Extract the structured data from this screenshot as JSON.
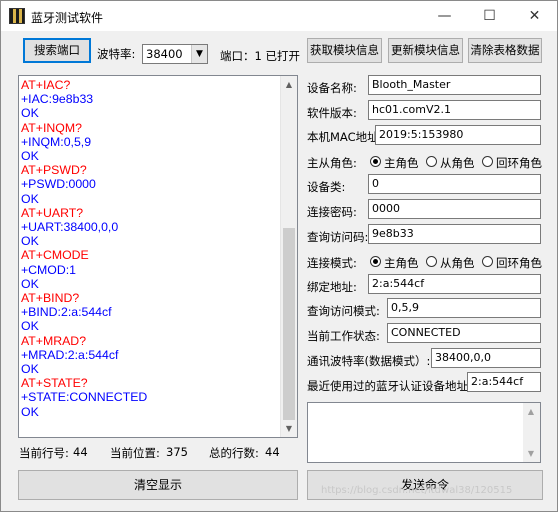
{
  "window": {
    "title": "蓝牙测试软件",
    "minimize_glyph": "—",
    "maximize_glyph": "☐",
    "close_glyph": "✕"
  },
  "toolbar": {
    "search_port_label": "搜索端口",
    "baud_label": "波特率:",
    "baud_value": "38400",
    "port_status": "端口：1 已打开",
    "get_info_label": "获取模块信息",
    "update_info_label": "更新模块信息",
    "clear_table_label": "清除表格数据"
  },
  "console": {
    "lines": [
      {
        "text": "AT+IAC?",
        "kind": "cmd"
      },
      {
        "text": "+IAC:9e8b33",
        "kind": "resp"
      },
      {
        "text": "OK",
        "kind": "resp"
      },
      {
        "text": "AT+INQM?",
        "kind": "cmd"
      },
      {
        "text": "+INQM:0,5,9",
        "kind": "resp"
      },
      {
        "text": "OK",
        "kind": "resp"
      },
      {
        "text": "AT+PSWD?",
        "kind": "cmd"
      },
      {
        "text": "+PSWD:0000",
        "kind": "resp"
      },
      {
        "text": "OK",
        "kind": "resp"
      },
      {
        "text": "AT+UART?",
        "kind": "cmd"
      },
      {
        "text": "+UART:38400,0,0",
        "kind": "resp"
      },
      {
        "text": "OK",
        "kind": "resp"
      },
      {
        "text": "AT+CMODE",
        "kind": "cmd"
      },
      {
        "text": "+CMOD:1",
        "kind": "resp"
      },
      {
        "text": "OK",
        "kind": "resp"
      },
      {
        "text": "AT+BIND?",
        "kind": "cmd"
      },
      {
        "text": "+BIND:2:a:544cf",
        "kind": "resp"
      },
      {
        "text": "OK",
        "kind": "resp"
      },
      {
        "text": "AT+MRAD?",
        "kind": "cmd"
      },
      {
        "text": "+MRAD:2:a:544cf",
        "kind": "resp"
      },
      {
        "text": "OK",
        "kind": "resp"
      },
      {
        "text": "AT+STATE?",
        "kind": "cmd"
      },
      {
        "text": "+STATE:CONNECTED",
        "kind": "resp"
      },
      {
        "text": "OK",
        "kind": "resp"
      }
    ],
    "colors": {
      "cmd": "#ff0000",
      "resp": "#0000ff"
    }
  },
  "status": {
    "current_line_label": "当前行号:",
    "current_line_value": "44",
    "current_pos_label": "当前位置:",
    "current_pos_value": "375",
    "total_lines_label": "总的行数:",
    "total_lines_value": "44"
  },
  "bottom": {
    "clear_display_label": "清空显示",
    "send_command_label": "发送命令"
  },
  "module": {
    "device_name_label": "设备名称:",
    "device_name_value": "Blooth_Master",
    "firmware_label": "软件版本:",
    "firmware_value": "hc01.comV2.1",
    "mac_label": "本机MAC地址",
    "mac_value": "2019:5:153980",
    "role_label": "主从角色:",
    "role_options": [
      "主角色",
      "从角色",
      "回环角色"
    ],
    "role_selected": 0,
    "device_class_label": "设备类:",
    "device_class_value": "0",
    "pin_label": "连接密码:",
    "pin_value": "0000",
    "iac_label": "查询访问码:",
    "iac_value": "9e8b33",
    "cmode_label": "连接模式:",
    "cmode_options": [
      "主角色",
      "从角色",
      "回环角色"
    ],
    "cmode_selected": 0,
    "bind_label": "绑定地址:",
    "bind_value": "2:a:544cf",
    "inqm_label": "查询访问模式:",
    "inqm_value": "0,5,9",
    "state_label": "当前工作状态:",
    "state_value": "CONNECTED",
    "uart_label": "通讯波特率(数据模式）:",
    "uart_value": "38400,0,0",
    "mrad_label": "最近使用过的蓝牙认证设备地址:",
    "mrad_value": "2:a:544cf"
  },
  "watermark": "https://blog.csdn.net/itdwal38/120515"
}
